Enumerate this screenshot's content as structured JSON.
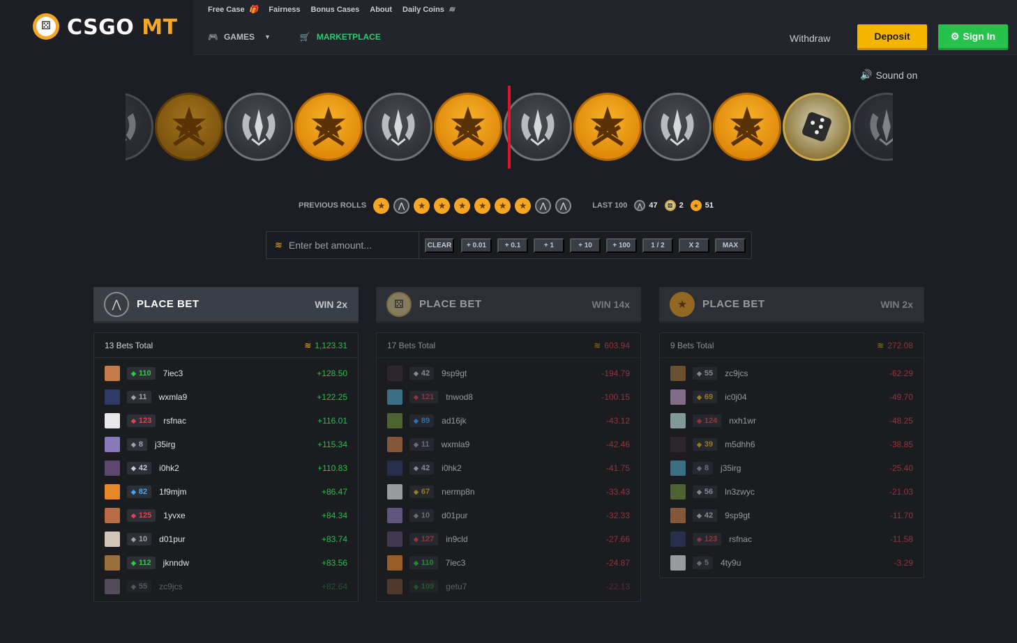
{
  "brand": {
    "name_white": "CSGO",
    "name_yellow": "MT"
  },
  "subnav": [
    {
      "label": "Free Case",
      "icon": "gift-icon"
    },
    {
      "label": "Fairness"
    },
    {
      "label": "Bonus Cases"
    },
    {
      "label": "About"
    },
    {
      "label": "Daily Coins",
      "icon": "coins-icon"
    }
  ],
  "mainnav": {
    "games": "GAMES",
    "marketplace": "MARKETPLACE"
  },
  "header_actions": {
    "withdraw": "Withdraw",
    "deposit": "Deposit",
    "signin": "Sign In"
  },
  "colors": {
    "gold": "#f5a623",
    "green": "#27c24c",
    "red": "#e0434f",
    "marker": "#e3122a"
  },
  "sound_label": "Sound on",
  "roulette": {
    "coins": [
      "ct",
      "t",
      "ct",
      "t",
      "ct",
      "t",
      "ct",
      "t",
      "ct",
      "t",
      "bonus",
      "ct"
    ]
  },
  "previous_rolls": {
    "label": "PREVIOUS ROLLS",
    "rolls": [
      "t",
      "ct",
      "t",
      "t",
      "t",
      "t",
      "t",
      "t",
      "ct",
      "ct"
    ],
    "last_label": "LAST 100",
    "counts": {
      "ct": "47",
      "bonus": "2",
      "t": "51"
    }
  },
  "bet_input": {
    "placeholder": "Enter bet amount...",
    "buttons": [
      "CLEAR",
      "+ 0.01",
      "+ 0.1",
      "+ 1",
      "+ 10",
      "+ 100",
      "1 / 2",
      "X 2",
      "MAX"
    ]
  },
  "columns": [
    {
      "side": "ct",
      "title": "PLACE BET",
      "win": "WIN 2x",
      "bets_total": "13 Bets Total",
      "amount": "1,123.31",
      "rows": [
        {
          "level": "110",
          "lvlcolor": "green",
          "name": "7iec3",
          "value": "+128.50"
        },
        {
          "level": "11",
          "lvlcolor": "grey",
          "name": "wxmla9",
          "value": "+122.25"
        },
        {
          "level": "123",
          "lvlcolor": "red",
          "name": "rsfnac",
          "value": "+116.01"
        },
        {
          "level": "8",
          "lvlcolor": "grey",
          "name": "j35irg",
          "value": "+115.34"
        },
        {
          "level": "42",
          "lvlcolor": "silver",
          "name": "i0hk2",
          "value": "+110.83"
        },
        {
          "level": "82",
          "lvlcolor": "blue",
          "name": "1f9mjm",
          "value": "+86.47"
        },
        {
          "level": "125",
          "lvlcolor": "red",
          "name": "1yvxe",
          "value": "+84.34"
        },
        {
          "level": "10",
          "lvlcolor": "grey",
          "name": "d01pur",
          "value": "+83.74"
        },
        {
          "level": "112",
          "lvlcolor": "green",
          "name": "jknndw",
          "value": "+83.56"
        },
        {
          "level": "55",
          "lvlcolor": "silver",
          "name": "zc9jcs",
          "value": "+82.64"
        }
      ]
    },
    {
      "side": "bonus",
      "title": "PLACE BET",
      "win": "WIN 14x",
      "bets_total": "17 Bets Total",
      "amount": "603.94",
      "rows": [
        {
          "level": "42",
          "lvlcolor": "silver",
          "name": "9sp9gt",
          "value": "-194.79"
        },
        {
          "level": "121",
          "lvlcolor": "red",
          "name": "tnwod8",
          "value": "-100.15"
        },
        {
          "level": "89",
          "lvlcolor": "blue",
          "name": "ad16jk",
          "value": "-43.12"
        },
        {
          "level": "11",
          "lvlcolor": "grey",
          "name": "wxmla9",
          "value": "-42.46"
        },
        {
          "level": "42",
          "lvlcolor": "silver",
          "name": "i0hk2",
          "value": "-41.75"
        },
        {
          "level": "67",
          "lvlcolor": "gold",
          "name": "nermp8n",
          "value": "-33.43"
        },
        {
          "level": "10",
          "lvlcolor": "grey",
          "name": "d01pur",
          "value": "-32.33"
        },
        {
          "level": "127",
          "lvlcolor": "red",
          "name": "in9cld",
          "value": "-27.66"
        },
        {
          "level": "110",
          "lvlcolor": "green",
          "name": "7iec3",
          "value": "-24.87"
        },
        {
          "level": "109",
          "lvlcolor": "green",
          "name": "getu7",
          "value": "-22.13"
        }
      ]
    },
    {
      "side": "t",
      "title": "PLACE BET",
      "win": "WIN 2x",
      "bets_total": "9 Bets Total",
      "amount": "272.08",
      "rows": [
        {
          "level": "55",
          "lvlcolor": "silver",
          "name": "zc9jcs",
          "value": "-62.29"
        },
        {
          "level": "69",
          "lvlcolor": "gold",
          "name": "ic0j04",
          "value": "-49.70"
        },
        {
          "level": "124",
          "lvlcolor": "red",
          "name": "nxh1wr",
          "value": "-48.25"
        },
        {
          "level": "39",
          "lvlcolor": "gold",
          "name": "m5dhh6",
          "value": "-38.85"
        },
        {
          "level": "8",
          "lvlcolor": "grey",
          "name": "j35irg",
          "value": "-25.40"
        },
        {
          "level": "56",
          "lvlcolor": "silver",
          "name": "ln3zwyc",
          "value": "-21.03"
        },
        {
          "level": "42",
          "lvlcolor": "silver",
          "name": "9sp9gt",
          "value": "-11.70"
        },
        {
          "level": "123",
          "lvlcolor": "red",
          "name": "rsfnac",
          "value": "-11.58"
        },
        {
          "level": "5",
          "lvlcolor": "grey",
          "name": "4ty9u",
          "value": "-3.29"
        }
      ]
    }
  ]
}
